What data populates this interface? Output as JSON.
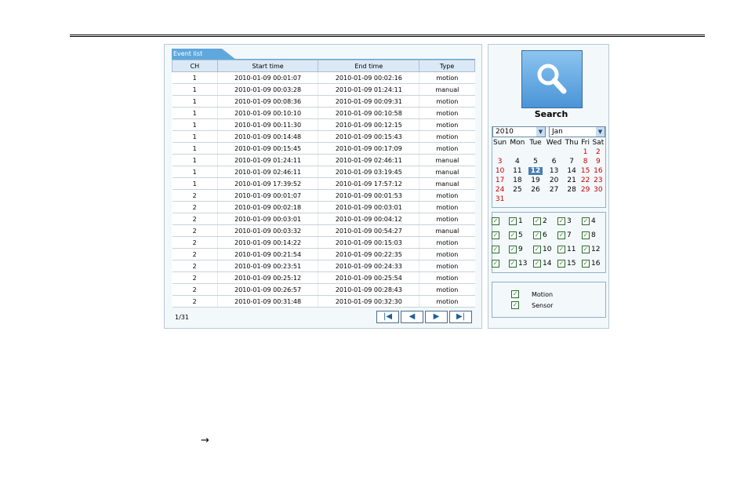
{
  "event_list": {
    "tab_label": "Event list",
    "columns": [
      "CH",
      "Start time",
      "End time",
      "Type"
    ],
    "rows": [
      [
        "1",
        "2010-01-09 00:01:07",
        "2010-01-09 00:02:16",
        "motion"
      ],
      [
        "1",
        "2010-01-09 00:03:28",
        "2010-01-09 01:24:11",
        "manual"
      ],
      [
        "1",
        "2010-01-09 00:08:36",
        "2010-01-09 00:09:31",
        "motion"
      ],
      [
        "1",
        "2010-01-09 00:10:10",
        "2010-01-09 00:10:58",
        "motion"
      ],
      [
        "1",
        "2010-01-09 00:11:30",
        "2010-01-09 00:12:15",
        "motion"
      ],
      [
        "1",
        "2010-01-09 00:14:48",
        "2010-01-09 00:15:43",
        "motion"
      ],
      [
        "1",
        "2010-01-09 00:15:45",
        "2010-01-09 00:17:09",
        "motion"
      ],
      [
        "1",
        "2010-01-09 01:24:11",
        "2010-01-09 02:46:11",
        "manual"
      ],
      [
        "1",
        "2010-01-09 02:46:11",
        "2010-01-09 03:19:45",
        "manual"
      ],
      [
        "1",
        "2010-01-09 17:39:52",
        "2010-01-09 17:57:12",
        "manual"
      ],
      [
        "2",
        "2010-01-09 00:01:07",
        "2010-01-09 00:01:53",
        "motion"
      ],
      [
        "2",
        "2010-01-09 00:02:18",
        "2010-01-09 00:03:01",
        "motion"
      ],
      [
        "2",
        "2010-01-09 00:03:01",
        "2010-01-09 00:04:12",
        "motion"
      ],
      [
        "2",
        "2010-01-09 00:03:32",
        "2010-01-09 00:54:27",
        "manual"
      ],
      [
        "2",
        "2010-01-09 00:14:22",
        "2010-01-09 00:15:03",
        "motion"
      ],
      [
        "2",
        "2010-01-09 00:21:54",
        "2010-01-09 00:22:35",
        "motion"
      ],
      [
        "2",
        "2010-01-09 00:23:51",
        "2010-01-09 00:24:33",
        "motion"
      ],
      [
        "2",
        "2010-01-09 00:25:12",
        "2010-01-09 00:25:54",
        "motion"
      ],
      [
        "2",
        "2010-01-09 00:26:57",
        "2010-01-09 00:28:43",
        "motion"
      ],
      [
        "2",
        "2010-01-09 00:31:48",
        "2010-01-09 00:32:30",
        "motion"
      ]
    ],
    "page_info": "1/31",
    "pager": {
      "first_icon": "first-page-icon",
      "prev_icon": "previous-page-icon",
      "next_icon": "next-page-icon",
      "last_icon": "last-page-icon"
    }
  },
  "search": {
    "label": "Search",
    "icon": "magnifier-icon",
    "year": "2010",
    "month": "Jan",
    "weekdays": [
      "Sun",
      "Mon",
      "Tue",
      "Wed",
      "Thu",
      "Fri",
      "Sat"
    ],
    "selected_day": "12",
    "weeks": [
      [
        "",
        "",
        "",
        "",
        "",
        "1",
        "2"
      ],
      [
        "3",
        "4",
        "5",
        "6",
        "7",
        "8",
        "9"
      ],
      [
        "10",
        "11",
        "12",
        "13",
        "14",
        "15",
        "16"
      ],
      [
        "17",
        "18",
        "19",
        "20",
        "21",
        "22",
        "23"
      ],
      [
        "24",
        "25",
        "26",
        "27",
        "28",
        "29",
        "30"
      ],
      [
        "31",
        "",
        "",
        "",
        "",
        "",
        ""
      ]
    ],
    "red_days": [
      "1",
      "2",
      "3",
      "8",
      "9",
      "10",
      "15",
      "16",
      "17",
      "22",
      "23",
      "24",
      "29",
      "30",
      "31"
    ],
    "channel_rows": [
      [
        "1",
        "2",
        "3",
        "4"
      ],
      [
        "5",
        "6",
        "7",
        "8"
      ],
      [
        "9",
        "10",
        "11",
        "12"
      ],
      [
        "13",
        "14",
        "15",
        "16"
      ]
    ],
    "event_types": [
      "Motion",
      "Sensor"
    ]
  },
  "colors": {
    "accent": "#5ea8dd",
    "weekend_red": "#cc0000"
  }
}
